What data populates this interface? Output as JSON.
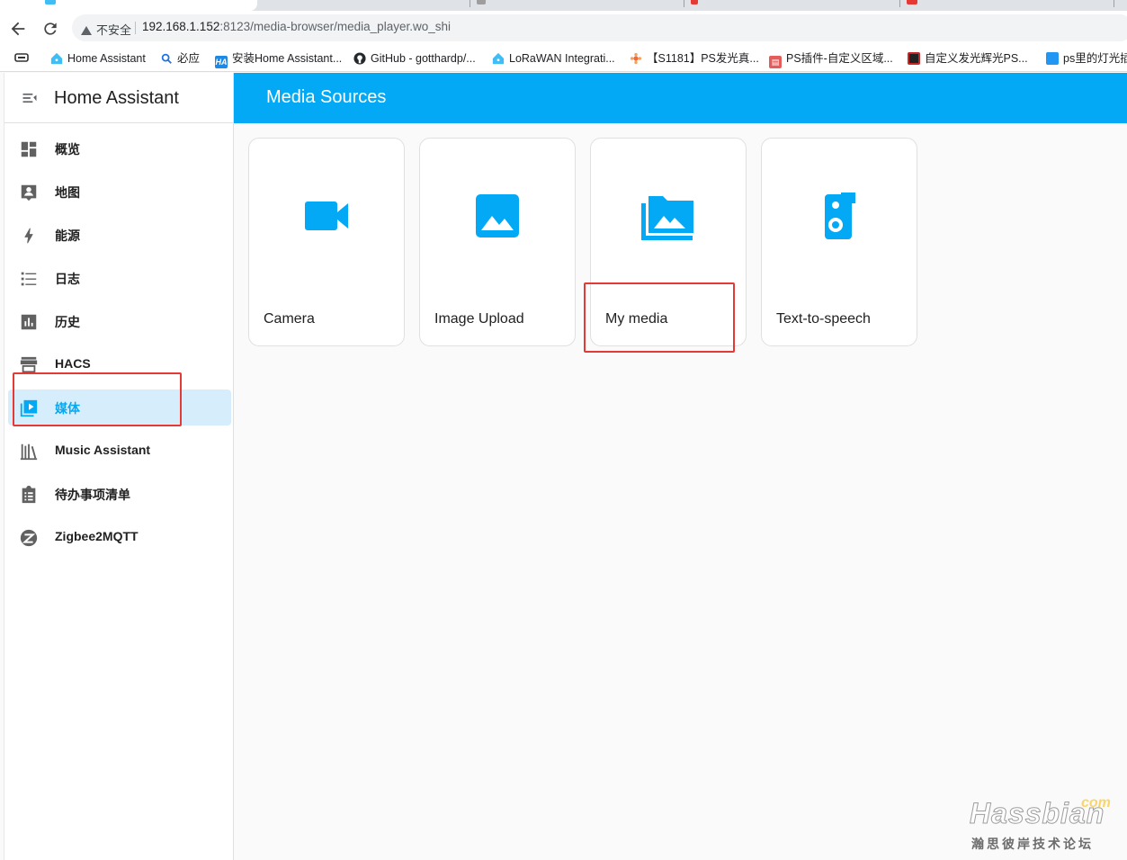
{
  "browser": {
    "security_label": "不安全",
    "url_host": "192.168.1.152",
    "url_rest": ":8123/media-browser/media_player.wo_shi",
    "bookmarks": [
      {
        "label": "Home Assistant",
        "icon": "home-assistant-icon",
        "color": "#41bdf5"
      },
      {
        "label": "必应",
        "icon": "search-icon",
        "color": "#1a73e8"
      },
      {
        "label": "安装Home Assistant...",
        "icon": "ha-text-icon",
        "color": "#1e88e5"
      },
      {
        "label": "GitHub - gotthardp/...",
        "icon": "github-icon",
        "color": "#24292e"
      },
      {
        "label": "LoRaWAN Integrati...",
        "icon": "home-assistant-icon",
        "color": "#41bdf5"
      },
      {
        "label": "【S1181】PS发光真...",
        "icon": "flower-icon",
        "color": "#ef6c35"
      },
      {
        "label": "PS插件-自定义区域...",
        "icon": "ps-plugin-icon",
        "color": "#e35d5b"
      },
      {
        "label": "自定义发光辉光PS...",
        "icon": "dark-app-icon",
        "color": "#222222"
      },
      {
        "label": "ps里的灯光插",
        "icon": "tv-icon",
        "color": "#2196f3"
      }
    ]
  },
  "app": {
    "title": "Home Assistant",
    "sidebar_items": [
      {
        "label": "概览",
        "icon": "dashboard-icon",
        "active": false
      },
      {
        "label": "地图",
        "icon": "map-account-icon",
        "active": false
      },
      {
        "label": "能源",
        "icon": "lightning-bolt-icon",
        "active": false
      },
      {
        "label": "日志",
        "icon": "format-list-icon",
        "active": false
      },
      {
        "label": "历史",
        "icon": "chart-box-icon",
        "active": false
      },
      {
        "label": "HACS",
        "icon": "hacs-store-icon",
        "active": false
      },
      {
        "label": "媒体",
        "icon": "play-box-multiple-icon",
        "active": true
      },
      {
        "label": "Music Assistant",
        "icon": "bookshelf-icon",
        "active": false
      },
      {
        "label": "待办事项清单",
        "icon": "clipboard-list-icon",
        "active": false
      },
      {
        "label": "Zigbee2MQTT",
        "icon": "zigbee-icon",
        "active": false
      }
    ],
    "page_title": "Media Sources",
    "cards": [
      {
        "label": "Camera",
        "icon": "video-camera-icon"
      },
      {
        "label": "Image Upload",
        "icon": "image-icon"
      },
      {
        "label": "My media",
        "icon": "folder-multiple-image-icon"
      },
      {
        "label": "Text-to-speech",
        "icon": "speaker-message-icon"
      }
    ],
    "accent_color": "#03a9f4"
  },
  "watermark": {
    "brand": "Hassbian",
    "suffix": "com",
    "subtitle": "瀚思彼岸技术论坛"
  }
}
